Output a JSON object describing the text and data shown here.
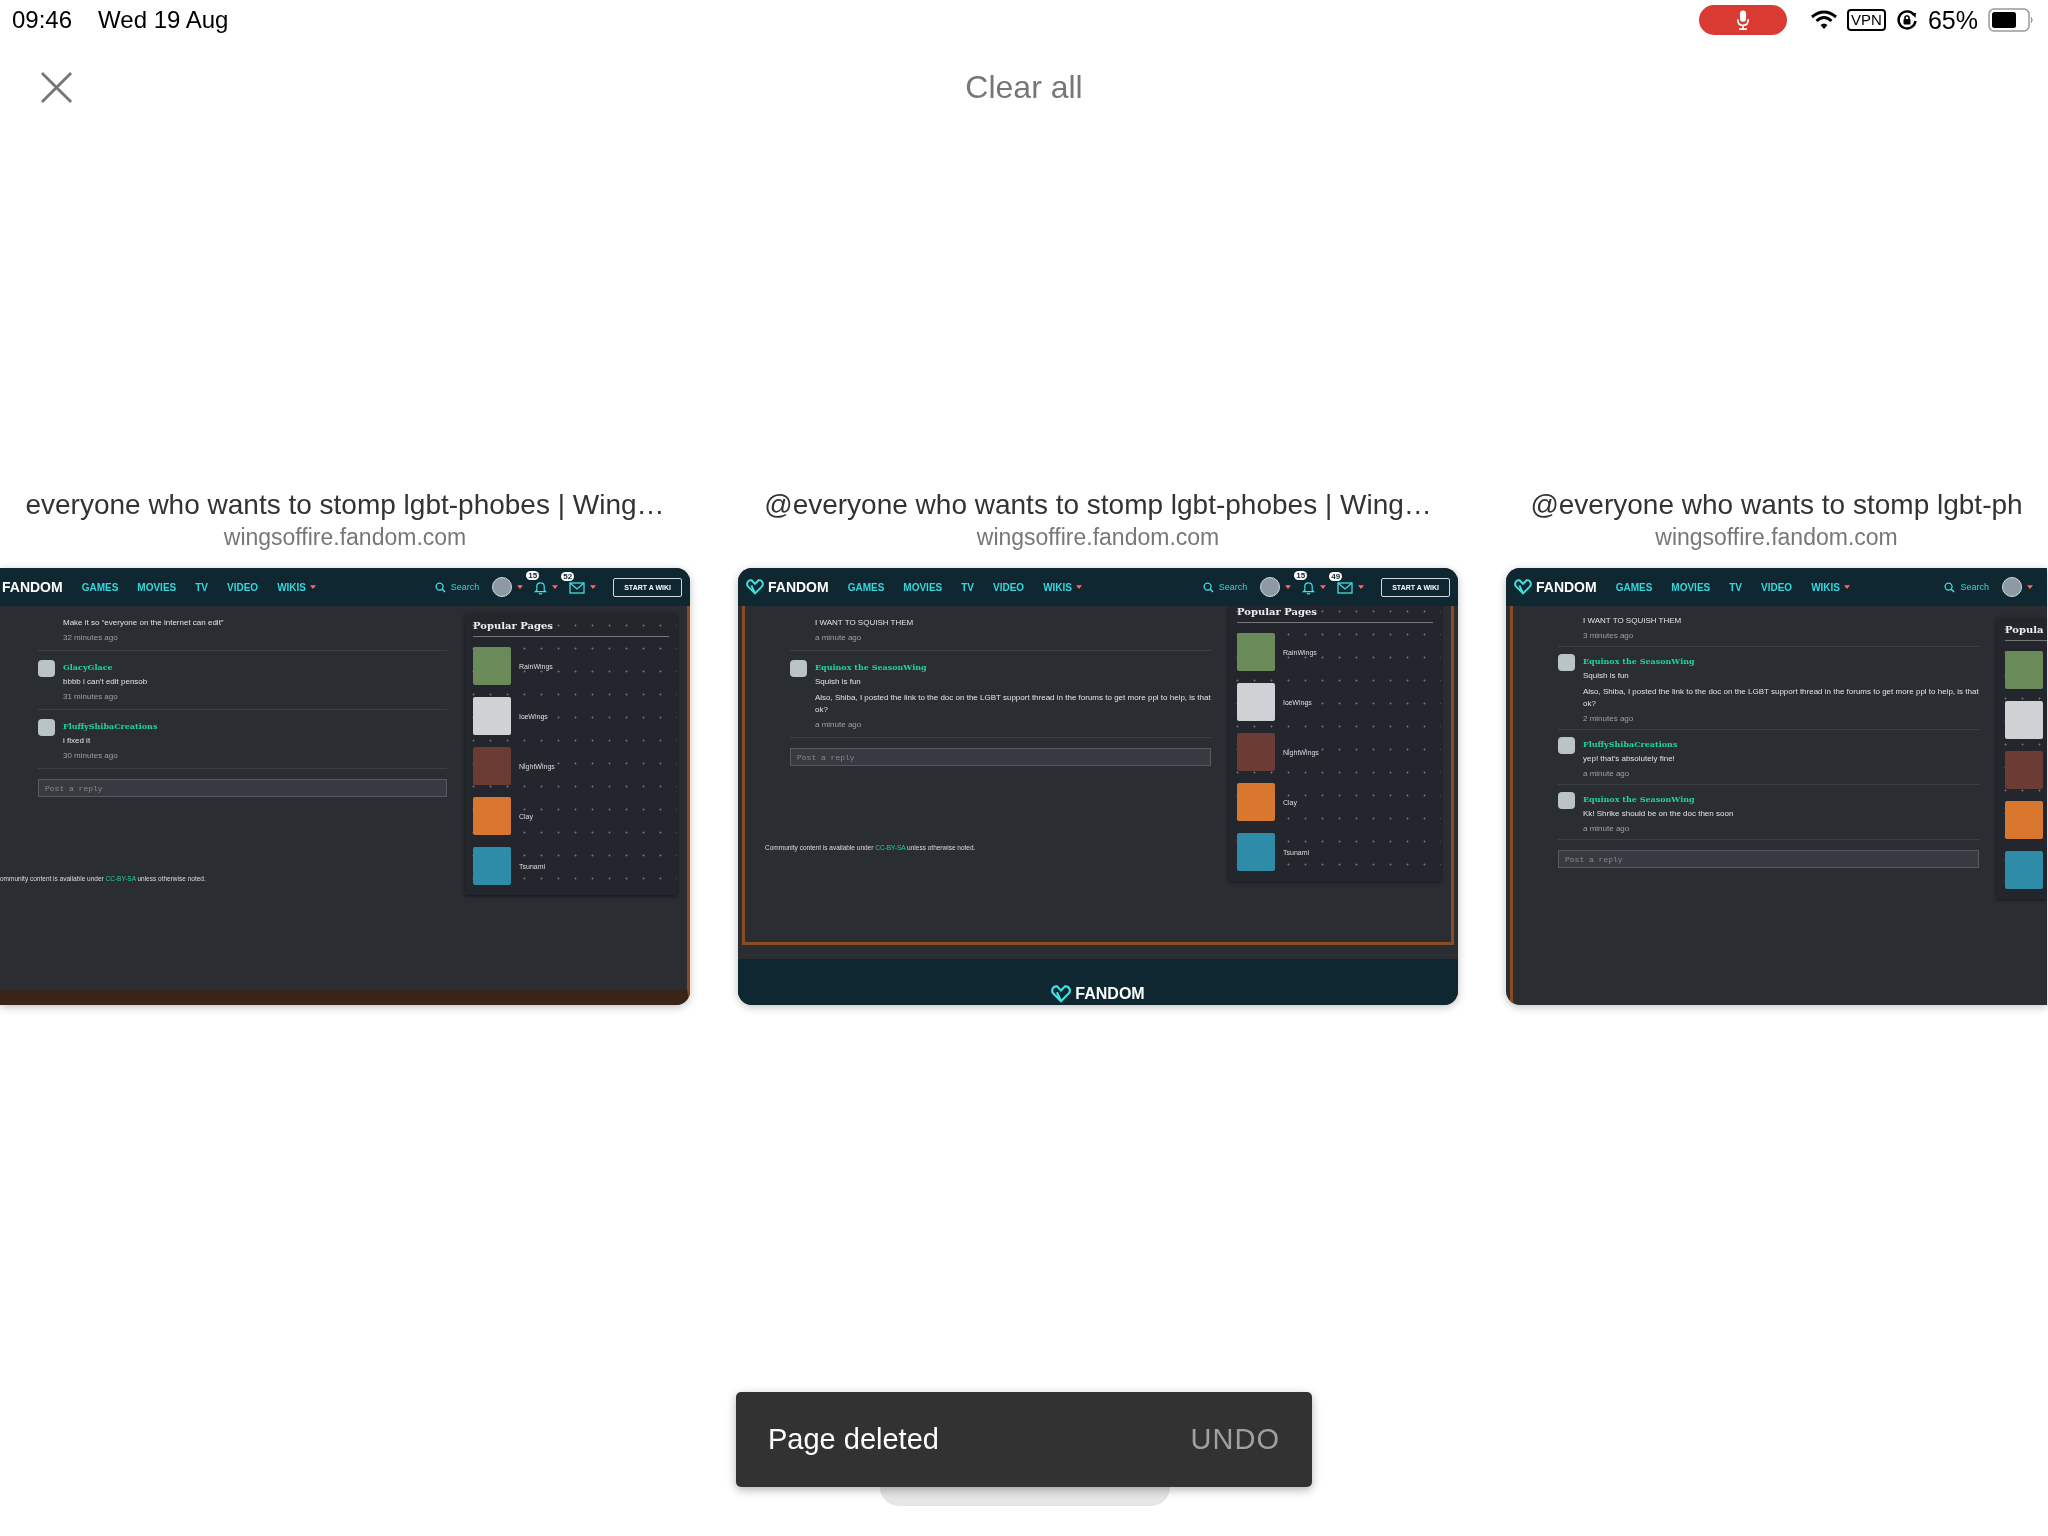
{
  "status_bar": {
    "time": "09:46",
    "date": "Wed 19 Aug",
    "vpn": "VPN",
    "battery": "65%"
  },
  "toolbar": {
    "clear_all": "Clear all"
  },
  "tabs": [
    {
      "title": "everyone who wants to stomp lgbt-phobes | Wing…",
      "domain": "wingsoffire.fandom.com",
      "page": {
        "nav": {
          "logo": "FANDOM",
          "logo_mark": false,
          "links": [
            {
              "label": "GAMES",
              "dropdown": false
            },
            {
              "label": "MOVIES",
              "dropdown": false
            },
            {
              "label": "TV",
              "dropdown": false
            },
            {
              "label": "VIDEO",
              "dropdown": false
            },
            {
              "label": "WIKIS",
              "dropdown": true
            }
          ],
          "search": "Search",
          "notifications": "15",
          "messages": "52",
          "start_button": "START A WIKI"
        },
        "comments": [
          {
            "lines": [
              "Make it so “everyone on the internet can edit”"
            ],
            "time": "32 minutes ago"
          },
          {
            "author": "GlacyGlace",
            "lines": [
              "bbbb i can't edit pensob"
            ],
            "time": "31 minutes ago"
          },
          {
            "author": "FluffyShibaCreations",
            "lines": [
              "i fixed it"
            ],
            "time": "30 minutes ago"
          }
        ],
        "reply_placeholder": "Post a reply",
        "popular_title": "Popular Pages",
        "popular_pages": [
          {
            "kind": "page",
            "name": "RainWings"
          },
          {
            "kind": "page",
            "name": "IceWings"
          },
          {
            "kind": "page",
            "name": "NightWings"
          },
          {
            "kind": "page",
            "name": "Clay"
          },
          {
            "kind": "page",
            "name": "Tsunami"
          }
        ],
        "license": {
          "before": "ommunity content is available under",
          "link": "CC-BY-SA",
          "after": "unless otherwise noted."
        }
      }
    },
    {
      "title": "@everyone who wants to stomp lgbt-phobes | Wing…",
      "domain": "wingsoffire.fandom.com",
      "page": {
        "nav": {
          "logo": "FANDOM",
          "logo_mark": true,
          "links": [
            {
              "label": "GAMES",
              "dropdown": false
            },
            {
              "label": "MOVIES",
              "dropdown": false
            },
            {
              "label": "TV",
              "dropdown": false
            },
            {
              "label": "VIDEO",
              "dropdown": false
            },
            {
              "label": "WIKIS",
              "dropdown": true
            }
          ],
          "search": "Search",
          "notifications": "15",
          "messages": "49",
          "start_button": "START A WIKI"
        },
        "comments": [
          {
            "lines": [
              "I WANT TO SQUISH THEM"
            ],
            "time": "a minute ago"
          },
          {
            "author": "Equinox the SeasonWing",
            "lines": [
              "Squish is fun",
              "Also, Shiba, I posted the link to the doc on the LGBT support thread in the forums to get more ppl to help, is that ok?"
            ],
            "time": "a minute ago"
          }
        ],
        "reply_placeholder": "Post a reply",
        "popular_title": "Popular Pages",
        "popular_pages": [
          {
            "kind": "page",
            "name": "RainWings"
          },
          {
            "kind": "page",
            "name": "IceWings"
          },
          {
            "kind": "page",
            "name": "NightWings"
          },
          {
            "kind": "page",
            "name": "Clay"
          },
          {
            "kind": "page",
            "name": "Tsunami"
          }
        ],
        "license": {
          "before": "Community content is available under",
          "link": "CC-BY-SA",
          "after": "unless otherwise noted."
        },
        "footer_logo": "FANDOM"
      }
    },
    {
      "title": "@everyone who wants to stomp lgbt-ph",
      "domain": "wingsoffire.fandom.com",
      "page": {
        "nav": {
          "logo": "FANDOM",
          "logo_mark": true,
          "links": [
            {
              "label": "GAMES",
              "dropdown": false
            },
            {
              "label": "MOVIES",
              "dropdown": false
            },
            {
              "label": "TV",
              "dropdown": false
            },
            {
              "label": "VIDEO",
              "dropdown": false
            },
            {
              "label": "WIKIS",
              "dropdown": true
            }
          ],
          "search": "Search"
        },
        "comments": [
          {
            "lines": [
              "I WANT TO SQUISH THEM"
            ],
            "time": "3 minutes ago"
          },
          {
            "author": "Equinox the SeasonWing",
            "lines": [
              "Squish is fun",
              "Also, Shiba, I posted the link to the doc on the LGBT support thread in the forums to get more ppl to help, is that ok?"
            ],
            "time": "2 minutes ago"
          },
          {
            "author": "FluffyShibaCreations",
            "lines": [
              "yep! that's absolutely fine!"
            ],
            "time": "a minute ago"
          },
          {
            "author": "Equinox the SeasonWing",
            "lines": [
              "Kk! Shrike should be on the doc then soon"
            ],
            "time": "a minute ago"
          }
        ],
        "reply_placeholder": "Post a reply",
        "popular_title": "Popula",
        "popular_pages": [
          {
            "kind": "page"
          },
          {
            "kind": "page"
          },
          {
            "kind": "page"
          },
          {
            "kind": "page"
          },
          {
            "kind": "page"
          }
        ]
      }
    }
  ],
  "snackbar": {
    "message": "Page deleted",
    "action": "UNDO"
  }
}
